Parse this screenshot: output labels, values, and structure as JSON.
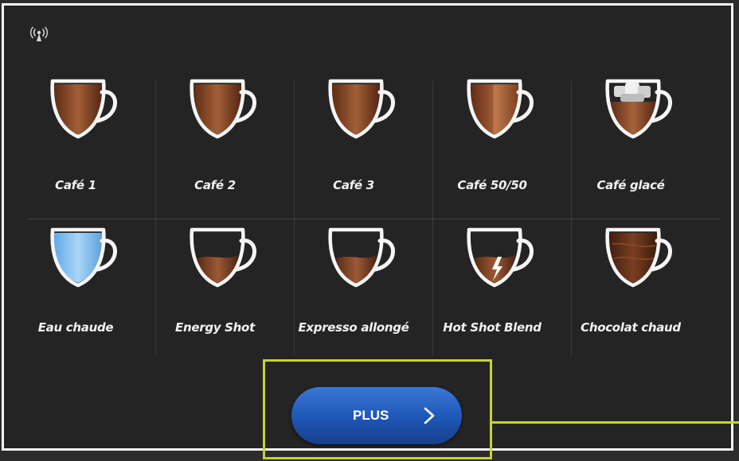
{
  "status": {
    "icon": "wifi-signal-icon"
  },
  "beverages": [
    {
      "id": "cafe-1",
      "label": "Café 1",
      "icon": "coffee-cup-icon"
    },
    {
      "id": "cafe-2",
      "label": "Café 2",
      "icon": "coffee-cup-icon"
    },
    {
      "id": "cafe-3",
      "label": "Café 3",
      "icon": "coffee-cup-icon"
    },
    {
      "id": "cafe-50-50",
      "label": "Café 50/50",
      "icon": "half-half-cup-icon"
    },
    {
      "id": "cafe-glace",
      "label": "Café glacé",
      "icon": "iced-coffee-cup-icon"
    },
    {
      "id": "eau-chaude",
      "label": "Eau chaude",
      "icon": "hot-water-cup-icon"
    },
    {
      "id": "energy-shot",
      "label": "Energy Shot",
      "icon": "energy-shot-cup-icon"
    },
    {
      "id": "expresso-allonge",
      "label": "Expresso allongé",
      "icon": "espresso-cup-icon"
    },
    {
      "id": "hot-shot-blend",
      "label": "Hot Shot Blend",
      "icon": "hot-shot-cup-icon"
    },
    {
      "id": "chocolat-chaud",
      "label": "Chocolat chaud",
      "icon": "chocolate-cup-icon"
    }
  ],
  "more_button": {
    "label": "PLUS",
    "icon": "chevron-right-icon",
    "color": "#1f5ec0"
  },
  "highlight": {
    "color": "#c4d42d"
  }
}
